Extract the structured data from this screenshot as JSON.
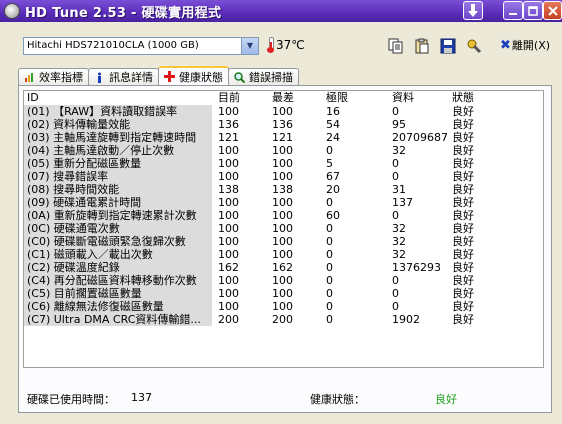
{
  "window": {
    "title": "HD Tune 2.53 - 硬碟實用程式"
  },
  "toolbar": {
    "drive": "Hitachi HDS721010CLA (1000 GB)",
    "temperature": "37℃",
    "exit_label": "離開(X)"
  },
  "tabs": [
    {
      "label": "效率指標",
      "icon": "chart-icon"
    },
    {
      "label": "訊息詳情",
      "icon": "info-icon"
    },
    {
      "label": "健康狀態",
      "icon": "health-cross-icon",
      "active": true
    },
    {
      "label": "錯誤掃描",
      "icon": "magnifier-icon"
    }
  ],
  "table": {
    "columns": [
      "ID",
      "目前",
      "最差",
      "極限",
      "資料",
      "狀態"
    ],
    "rows": [
      [
        "(01) 【RAW】資料讀取錯誤率",
        "100",
        "100",
        "16",
        "0",
        "良好"
      ],
      [
        "(02) 資料傳輸量效能",
        "136",
        "136",
        "54",
        "95",
        "良好"
      ],
      [
        "(03) 主軸馬達旋轉到指定轉速時間",
        "121",
        "121",
        "24",
        "20709687",
        "良好"
      ],
      [
        "(04) 主軸馬達啟動／停止次數",
        "100",
        "100",
        "0",
        "32",
        "良好"
      ],
      [
        "(05) 重新分配磁區數量",
        "100",
        "100",
        "5",
        "0",
        "良好"
      ],
      [
        "(07) 搜尋錯誤率",
        "100",
        "100",
        "67",
        "0",
        "良好"
      ],
      [
        "(08) 搜尋時間效能",
        "138",
        "138",
        "20",
        "31",
        "良好"
      ],
      [
        "(09) 硬碟通電累計時間",
        "100",
        "100",
        "0",
        "137",
        "良好"
      ],
      [
        "(0A) 重新旋轉到指定轉速累計次數",
        "100",
        "100",
        "60",
        "0",
        "良好"
      ],
      [
        "(0C) 硬碟通電次數",
        "100",
        "100",
        "0",
        "32",
        "良好"
      ],
      [
        "(C0) 硬碟斷電磁頭緊急復歸次數",
        "100",
        "100",
        "0",
        "32",
        "良好"
      ],
      [
        "(C1) 磁頭載入／載出次數",
        "100",
        "100",
        "0",
        "32",
        "良好"
      ],
      [
        "(C2) 硬碟溫度紀錄",
        "162",
        "162",
        "0",
        "1376293",
        "良好"
      ],
      [
        "(C4) 再分配磁區資料轉移動作次數",
        "100",
        "100",
        "0",
        "0",
        "良好"
      ],
      [
        "(C5) 目前擱置磁區數量",
        "100",
        "100",
        "0",
        "0",
        "良好"
      ],
      [
        "(C6) 離線無法修復磁區數量",
        "100",
        "100",
        "0",
        "0",
        "良好"
      ],
      [
        "(C7) Ultra DMA CRC資料傳輸錯...",
        "200",
        "200",
        "0",
        "1902",
        "良好"
      ]
    ]
  },
  "footer": {
    "power_on_label": "硬碟已使用時間：",
    "power_on_value": "137",
    "health_label": "健康狀態：",
    "health_value": "良好"
  }
}
